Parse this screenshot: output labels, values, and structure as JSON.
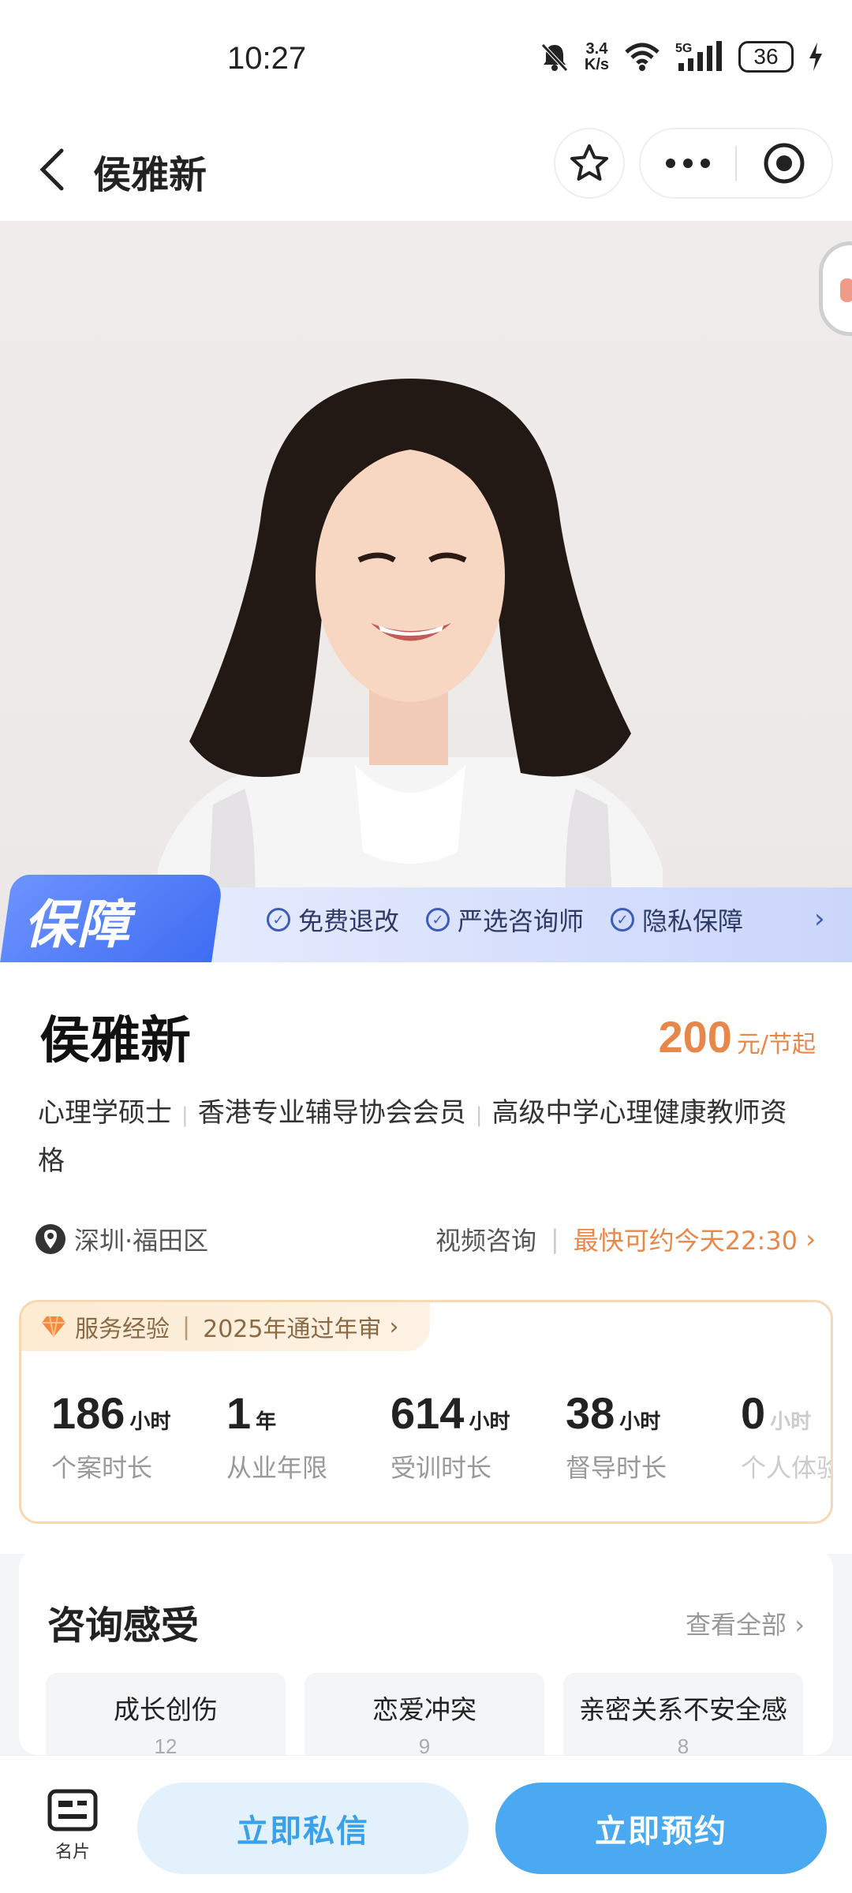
{
  "status_bar": {
    "time": "10:27",
    "net_speed_top": "3.4",
    "net_speed_bottom": "K/s",
    "network": "5G",
    "battery": "36"
  },
  "nav": {
    "title": "侯雅新"
  },
  "guarantee": {
    "badge": "保障",
    "items": [
      "免费退改",
      "严选咨询师",
      "隐私保障"
    ]
  },
  "profile": {
    "name": "侯雅新",
    "price": "200",
    "price_unit": "元/节起",
    "credentials": [
      "心理学硕士",
      "香港专业辅导协会会员",
      "高级中学心理健康教师资格"
    ],
    "location": "深圳·福田区",
    "consult_mode": "视频咨询",
    "earliest": "最快可约今天22:30"
  },
  "experience": {
    "tag_title": "服务经验",
    "tag_note": "2025年通过年审",
    "stats": [
      {
        "value": "186",
        "unit": "小时",
        "label": "个案时长"
      },
      {
        "value": "1",
        "unit": "年",
        "label": "从业年限"
      },
      {
        "value": "614",
        "unit": "小时",
        "label": "受训时长"
      },
      {
        "value": "38",
        "unit": "小时",
        "label": "督导时长"
      },
      {
        "value": "0",
        "unit": "小时",
        "label": "个人体验"
      }
    ]
  },
  "feelings": {
    "title": "咨询感受",
    "view_all": "查看全部",
    "tags": [
      {
        "name": "成长创伤",
        "count": "12"
      },
      {
        "name": "恋爱冲突",
        "count": "9"
      },
      {
        "name": "亲密关系不安全感",
        "count": "8"
      }
    ]
  },
  "bottom": {
    "card_label": "名片",
    "message": "立即私信",
    "book": "立即预约"
  },
  "colors": {
    "accent_orange": "#e8874a",
    "primary_blue": "#4aa9f0",
    "guarantee_blue": "#3f6df2"
  }
}
